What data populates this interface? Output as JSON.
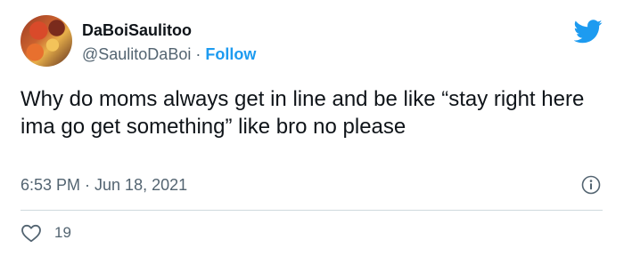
{
  "user": {
    "display_name": "DaBoiSaulitoo",
    "handle": "@SaulitoDaBoi",
    "separator": "·",
    "follow_label": "Follow"
  },
  "tweet": {
    "text": "Why do moms always get in line and be like “stay right here ima go get something” like bro no please",
    "time": "6:53 PM · Jun 18, 2021"
  },
  "actions": {
    "like_count": "19"
  },
  "icons": {
    "brand": "twitter-bird-icon",
    "info": "info-icon",
    "like": "heart-icon"
  },
  "colors": {
    "accent": "#1d9bf0",
    "text": "#0f1419",
    "secondary": "#536471",
    "divider": "#cfd9de"
  }
}
